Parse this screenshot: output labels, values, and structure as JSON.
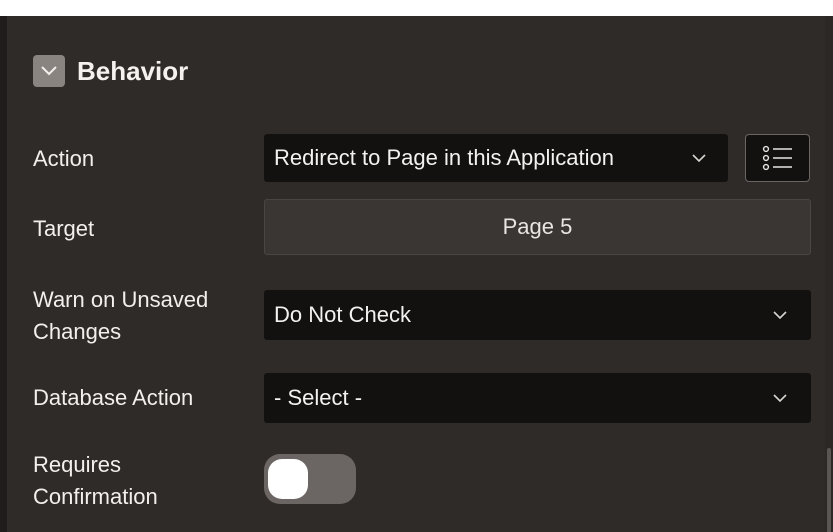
{
  "section": {
    "title": "Behavior",
    "collapse_icon": "chevron-down-icon"
  },
  "action": {
    "label": "Action",
    "value": "Redirect to Page in this Application",
    "list_button_icon": "list-icon"
  },
  "target": {
    "label": "Target",
    "value": "Page 5"
  },
  "warn_on_unsaved": {
    "label_line1": "Warn on Unsaved",
    "label_line2": "Changes",
    "value": "Do Not Check"
  },
  "database_action": {
    "label": "Database Action",
    "value": "- Select -"
  },
  "requires_confirmation": {
    "label_line1": "Requires",
    "label_line2": "Confirmation",
    "enabled": false
  },
  "colors": {
    "panel_bg": "#2f2b29",
    "field_bg": "#121110",
    "toggle_off": "#6b6663",
    "text": "#f2efec"
  }
}
